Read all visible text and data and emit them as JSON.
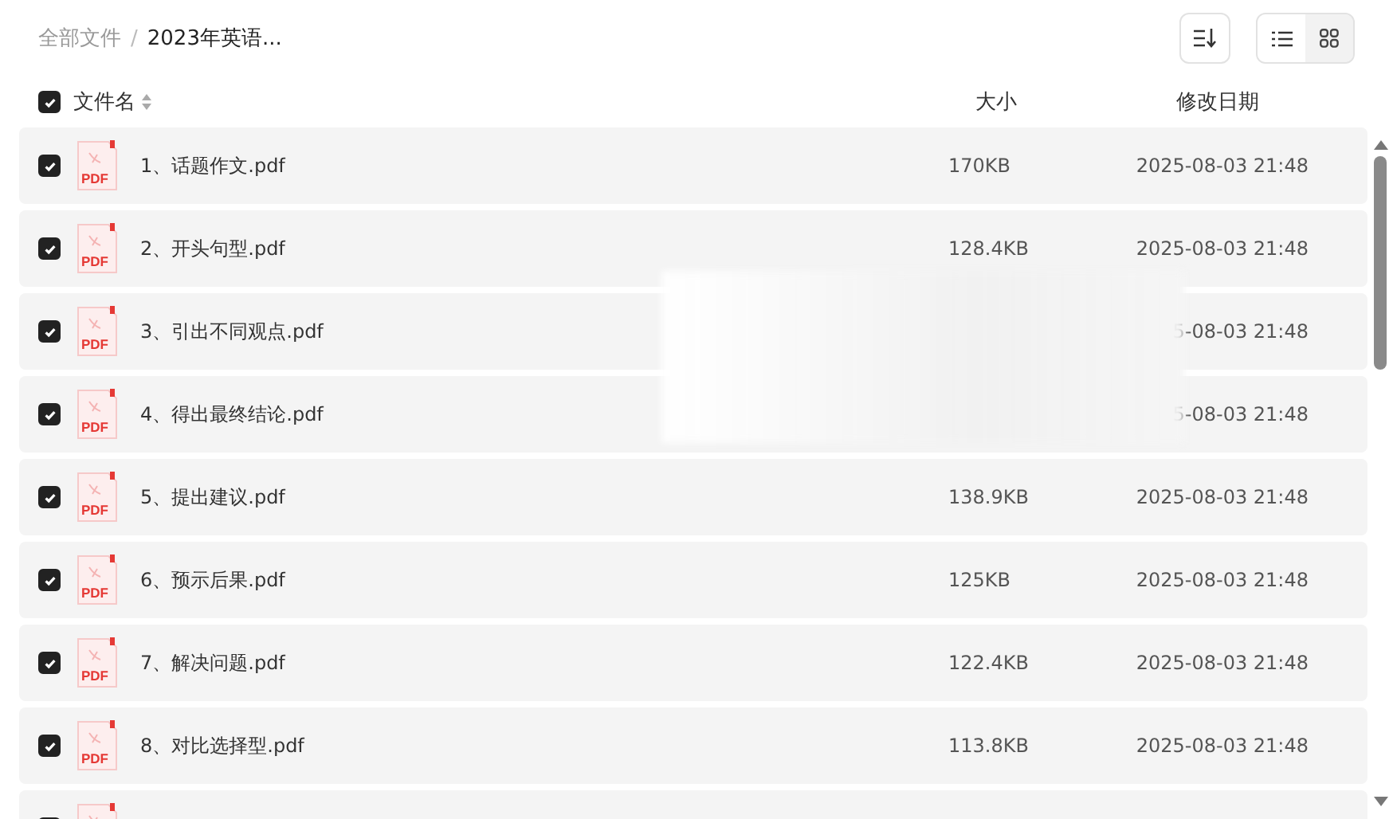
{
  "breadcrumb_separator": "/",
  "breadcrumb": [
    {
      "label": "全部文件",
      "current": false
    },
    {
      "label": "2023年英语...",
      "current": true
    }
  ],
  "view_modes": [
    {
      "kind": "list",
      "selected": true
    },
    {
      "kind": "grid",
      "selected": false
    }
  ],
  "header": {
    "select_all": true,
    "columns": [
      "文件名",
      "大小",
      "修改日期"
    ]
  },
  "files": [
    {
      "type": "PDF",
      "name": "1、话题作文.pdf",
      "size": "170KB",
      "date": "2025-08-03 21:48",
      "checked": true
    },
    {
      "type": "PDF",
      "name": "2、开头句型.pdf",
      "size": "128.4KB",
      "date": "2025-08-03 21:48",
      "checked": true
    },
    {
      "type": "PDF",
      "name": "3、引出不同观点.pdf",
      "date": "5-08-03 21:48",
      "checked": true
    },
    {
      "type": "PDF",
      "name": "4、得出最终结论.pdf",
      "date": "5-08-03 21:48",
      "checked": true
    },
    {
      "type": "PDF",
      "name": "5、提出建议.pdf",
      "size": "138.9KB",
      "date": "2025-08-03 21:48",
      "checked": true
    },
    {
      "type": "PDF",
      "name": "6、预示后果.pdf",
      "size": "125KB",
      "date": "2025-08-03 21:48",
      "checked": true
    },
    {
      "type": "PDF",
      "name": "7、解决问题.pdf",
      "size": "122.4KB",
      "date": "2025-08-03 21:48",
      "checked": true
    },
    {
      "type": "PDF",
      "name": "8、对比选择型.pdf",
      "size": "113.8KB",
      "date": "2025-08-03 21:48",
      "checked": true
    },
    {
      "checked": true
    }
  ]
}
